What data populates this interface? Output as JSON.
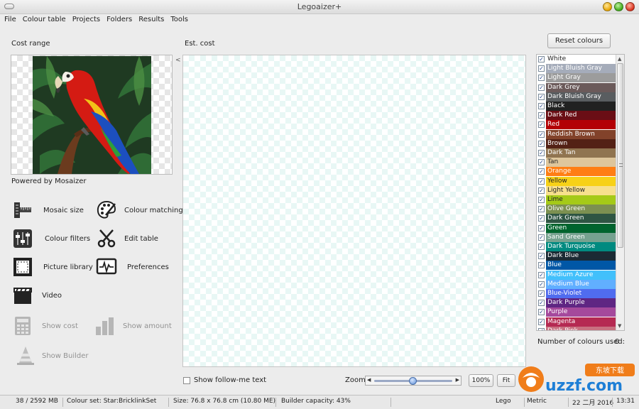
{
  "window": {
    "title": "Legoaizer+"
  },
  "menu": [
    "File",
    "Colour table",
    "Projects",
    "Folders",
    "Results",
    "Tools"
  ],
  "left_panel": {
    "cost_range_label": "Cost range",
    "powered_by": "Powered by Mosaizer",
    "tools": [
      {
        "label": "Mosaic size",
        "icon": "ruler-icon"
      },
      {
        "label": "Colour matching",
        "icon": "palette-icon"
      },
      {
        "label": "Colour filters",
        "icon": "sliders-icon"
      },
      {
        "label": "Edit table",
        "icon": "scissors-icon"
      },
      {
        "label": "Picture library",
        "icon": "picture-frame-icon"
      },
      {
        "label": "Preferences",
        "icon": "monitor-waveform-icon"
      },
      {
        "label": "Video",
        "icon": "clapperboard-icon"
      },
      {
        "label": "Show cost",
        "icon": "calculator-icon",
        "disabled": true
      },
      {
        "label": "Show amount",
        "icon": "bar-chart-icon",
        "disabled": true
      },
      {
        "label": "Show Builder",
        "icon": "cone-icon",
        "disabled": true
      }
    ]
  },
  "canvas": {
    "label": "Est. cost",
    "collapse_glyph": "<"
  },
  "colours": {
    "reset_label": "Reset colours",
    "count_label": "Number of colours used:",
    "count_value": "0",
    "items": [
      {
        "name": "White",
        "color": "#ffffff",
        "text": "#222222"
      },
      {
        "name": "Light Bluish Gray",
        "color": "#a5acba",
        "text": "#ffffff"
      },
      {
        "name": "Light Gray",
        "color": "#9c9c9c",
        "text": "#ffffff"
      },
      {
        "name": "Dark Grey",
        "color": "#6b5a5a",
        "text": "#ffffff"
      },
      {
        "name": "Dark Bluish Gray",
        "color": "#595d60",
        "text": "#ffffff"
      },
      {
        "name": "Black",
        "color": "#212121",
        "text": "#ffffff"
      },
      {
        "name": "Dark Red",
        "color": "#6a0e15",
        "text": "#ffffff"
      },
      {
        "name": "Red",
        "color": "#b30006",
        "text": "#ffffff"
      },
      {
        "name": "Reddish Brown",
        "color": "#82422a",
        "text": "#ffffff"
      },
      {
        "name": "Brown",
        "color": "#532115",
        "text": "#ffffff"
      },
      {
        "name": "Dark Tan",
        "color": "#907450",
        "text": "#ffffff"
      },
      {
        "name": "Tan",
        "color": "#dec69c",
        "text": "#222222"
      },
      {
        "name": "Orange",
        "color": "#ff7e14",
        "text": "#ffffff"
      },
      {
        "name": "Yellow",
        "color": "#f7d117",
        "text": "#222222"
      },
      {
        "name": "Light Yellow",
        "color": "#f7e08d",
        "text": "#222222"
      },
      {
        "name": "Lime",
        "color": "#a5ca18",
        "text": "#222222"
      },
      {
        "name": "Olive Green",
        "color": "#7c9051",
        "text": "#ffffff"
      },
      {
        "name": "Dark Green",
        "color": "#2e5543",
        "text": "#ffffff"
      },
      {
        "name": "Green",
        "color": "#00642e",
        "text": "#ffffff"
      },
      {
        "name": "Sand Green",
        "color": "#76a290",
        "text": "#ffffff"
      },
      {
        "name": "Dark Turquoise",
        "color": "#008a80",
        "text": "#ffffff"
      },
      {
        "name": "Dark Blue",
        "color": "#1b2a34",
        "text": "#ffffff"
      },
      {
        "name": "Blue",
        "color": "#0057a6",
        "text": "#ffffff"
      },
      {
        "name": "Medium Azure",
        "color": "#42c0fb",
        "text": "#ffffff"
      },
      {
        "name": "Medium Blue",
        "color": "#61afff",
        "text": "#ffffff"
      },
      {
        "name": "Blue-Violet",
        "color": "#506cef",
        "text": "#ffffff"
      },
      {
        "name": "Dark Purple",
        "color": "#5f2683",
        "text": "#ffffff"
      },
      {
        "name": "Purple",
        "color": "#a5499c",
        "text": "#ffffff"
      },
      {
        "name": "Magenta",
        "color": "#b52952",
        "text": "#ffffff"
      },
      {
        "name": "Dark Pink",
        "color": "#c87080",
        "text": "#ffffff"
      }
    ]
  },
  "bottom": {
    "show_follow_me": "Show follow-me text",
    "zoom_label": "Zoom",
    "zoom_level": 0.49,
    "zoom_percent": "100%",
    "fit_label": "Fit"
  },
  "status": {
    "memory": "38 / 2592 MB",
    "colour_set": "Colour set: Star:BricklinkSet",
    "size": "Size: 76.8 x 76.8 cm (10.80 ME)",
    "builder_capacity": "Builder capacity: 43%",
    "brand": "Lego",
    "units": "Metric",
    "date": "22 二月 2016",
    "time": "13:31"
  },
  "watermark": {
    "text": "uzzf.com",
    "badge": "东坡下载"
  },
  "accent": "#3a7bd5"
}
